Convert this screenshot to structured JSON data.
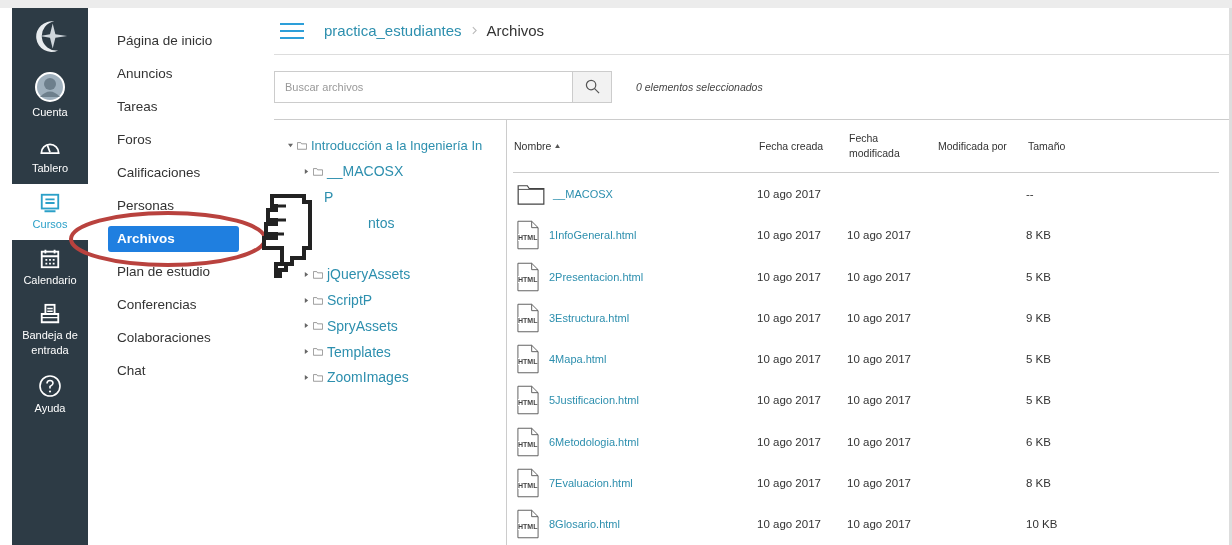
{
  "global_nav": [
    {
      "label": "Cuenta",
      "kind": "avatar",
      "selected": false
    },
    {
      "label": "Tablero",
      "kind": "dashboard",
      "selected": false
    },
    {
      "label": "Cursos",
      "kind": "courses",
      "selected": true
    },
    {
      "label": "Calendario",
      "kind": "calendar",
      "selected": false
    },
    {
      "label": "Bandeja de entrada",
      "kind": "inbox",
      "selected": false
    },
    {
      "label": "Ayuda",
      "kind": "help",
      "selected": false
    }
  ],
  "course_nav": [
    {
      "label": "Página de inicio",
      "selected": false
    },
    {
      "label": "Anuncios",
      "selected": false
    },
    {
      "label": "Tareas",
      "selected": false
    },
    {
      "label": "Foros",
      "selected": false
    },
    {
      "label": "Calificaciones",
      "selected": false
    },
    {
      "label": "Personas",
      "selected": false
    },
    {
      "label": "Archivos",
      "selected": true
    },
    {
      "label": "Plan de estudio",
      "selected": false
    },
    {
      "label": "Conferencias",
      "selected": false
    },
    {
      "label": "Colaboraciones",
      "selected": false
    },
    {
      "label": "Chat",
      "selected": false
    }
  ],
  "breadcrumb": [
    "practica_estudiantes",
    "Archivos"
  ],
  "search": {
    "placeholder": "Buscar archivos"
  },
  "selection_count": "0 elementos seleccionados",
  "tree": {
    "label": "Introducción a la Ingeniería In",
    "expanded": true,
    "children": [
      {
        "label": "__MACOSX",
        "kind": "folder"
      },
      {
        "label": "P",
        "kind": "partial"
      },
      {
        "label": "ntos",
        "kind": "partial"
      },
      {
        "label": "jQueryAssets",
        "kind": "folder"
      },
      {
        "label": "ScriptP",
        "kind": "folder"
      },
      {
        "label": "SpryAssets",
        "kind": "folder"
      },
      {
        "label": "Templates",
        "kind": "folder"
      },
      {
        "label": "ZoomImages",
        "kind": "folder"
      }
    ]
  },
  "table": {
    "columns": [
      {
        "label": "Nombre",
        "sorted": true
      },
      {
        "label": "Fecha creada",
        "sorted": false
      },
      {
        "label": "Fecha modificada",
        "sorted": false
      },
      {
        "label": "Modificada por",
        "sorted": false
      },
      {
        "label": "Tamaño",
        "sorted": false
      }
    ],
    "rows": [
      {
        "kind": "folder",
        "name": "__MACOSX",
        "created": "10 ago 2017",
        "size": "--"
      },
      {
        "kind": "html",
        "type_label": "HTML",
        "name": "1InfoGeneral.html",
        "created": "10 ago 2017",
        "modified": "10 ago 2017",
        "size": "8 KB"
      },
      {
        "kind": "html",
        "type_label": "HTML",
        "name": "2Presentacion.html",
        "created": "10 ago 2017",
        "modified": "10 ago 2017",
        "size": "5 KB"
      },
      {
        "kind": "html",
        "type_label": "HTML",
        "name": "3Estructura.html",
        "created": "10 ago 2017",
        "modified": "10 ago 2017",
        "size": "9 KB"
      },
      {
        "kind": "html",
        "type_label": "HTML",
        "name": "4Mapa.html",
        "created": "10 ago 2017",
        "modified": "10 ago 2017",
        "size": "5 KB"
      },
      {
        "kind": "html",
        "type_label": "HTML",
        "name": "5Justificacion.html",
        "created": "10 ago 2017",
        "modified": "10 ago 2017",
        "size": "5 KB"
      },
      {
        "kind": "html",
        "type_label": "HTML",
        "name": "6Metodologia.html",
        "created": "10 ago 2017",
        "modified": "10 ago 2017",
        "size": "6 KB"
      },
      {
        "kind": "html",
        "type_label": "HTML",
        "name": "7Evaluacion.html",
        "created": "10 ago 2017",
        "modified": "10 ago 2017",
        "size": "8 KB"
      },
      {
        "kind": "html",
        "type_label": "HTML",
        "name": "8Glosario.html",
        "created": "10 ago 2017",
        "modified": "10 ago 2017",
        "size": "10 KB"
      }
    ]
  }
}
